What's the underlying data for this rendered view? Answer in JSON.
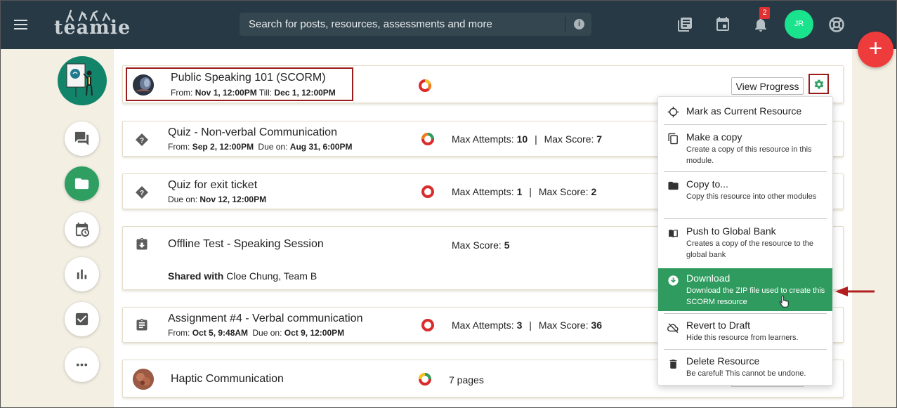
{
  "header": {
    "logo_text": "teamie",
    "search": {
      "placeholder": "Search for posts, resources, assessments and more"
    },
    "notification_count": "2",
    "avatar_initials": "JR",
    "icons": [
      "menu-icon",
      "info-icon",
      "book-icon",
      "calendar-icon",
      "bell-icon",
      "help-lifebuoy-icon"
    ]
  },
  "fab_label": "+",
  "rail": {
    "items": [
      "posts-icon",
      "resources-folder-icon",
      "schedule-icon",
      "bar-chart-icon",
      "checkbox-icon",
      "more-icon"
    ],
    "active": "resources-folder-icon"
  },
  "resources": [
    {
      "title": "Public Speaking 101 (SCORM)",
      "meta_from_label": "From:",
      "meta_from": "Nov 1, 12:00PM",
      "meta_till_label": "Till:",
      "meta_till": "Dec 1, 12:00PM",
      "button": "View Progress",
      "icon": "scorm-thumbnail"
    },
    {
      "title": "Quiz - Non-verbal Communication",
      "meta_from_label": "From:",
      "meta_from": "Sep 2, 12:00PM",
      "meta_due_label": "Due on:",
      "meta_due": "Aug 31, 6:00PM",
      "attempts_label": "Max Attempts:",
      "attempts": "10",
      "score_label": "Max Score:",
      "score": "7",
      "icon": "quiz-icon"
    },
    {
      "title": "Quiz for exit ticket",
      "meta_due_label": "Due on:",
      "meta_due": "Nov 12, 12:00PM",
      "attempts_label": "Max Attempts:",
      "attempts": "1",
      "score_label": "Max Score:",
      "score": "2",
      "icon": "quiz-icon"
    },
    {
      "title": "Offline Test - Speaking Session",
      "score_label": "Max Score:",
      "score": "5",
      "shared_label": "Shared with",
      "shared_with": "Cloe Chung, Team B",
      "icon": "offline-test-icon"
    },
    {
      "title": "Assignment #4 - Verbal communication",
      "meta_from_label": "From:",
      "meta_from": "Oct 5, 9:48AM",
      "meta_due_label": "Due on:",
      "meta_due": "Oct 9, 12:00PM",
      "attempts_label": "Max Attempts:",
      "attempts": "3",
      "score_label": "Max Score:",
      "score": "36",
      "icon": "assignment-icon"
    },
    {
      "title": "Haptic Communication",
      "pages": "7 pages",
      "icon": "page-thumbnail"
    }
  ],
  "separator": "|",
  "menu": {
    "items": [
      {
        "label": "Mark as Current Resource",
        "desc": "",
        "icon": "crosshair-icon"
      },
      {
        "label": "Make a copy",
        "desc": "Create a copy of this resource in this module.",
        "icon": "copy-icon"
      },
      {
        "label": "Copy to...",
        "desc": "Copy this resource into other modules",
        "icon": "folder-icon"
      },
      {
        "label": "Push to Global Bank",
        "desc": "Creates a copy of the resource to the global bank",
        "icon": "book-open-icon"
      },
      {
        "label": "Download",
        "desc": "Download the ZIP file used to create this SCORM resource",
        "icon": "download-icon"
      },
      {
        "label": "Revert to Draft",
        "desc": "Hide this resource from learners.",
        "icon": "cloud-off-icon"
      },
      {
        "label": "Delete Resource",
        "desc": "Be careful! This cannot be undone.",
        "icon": "trash-icon"
      }
    ],
    "highlighted": "Download"
  },
  "colors": {
    "topbar": "#263945",
    "accent_green": "#2e9e61",
    "annotation_red": "#9b1c1c",
    "fab_red": "#ee3b3b",
    "avatar_green": "#19e38c"
  }
}
